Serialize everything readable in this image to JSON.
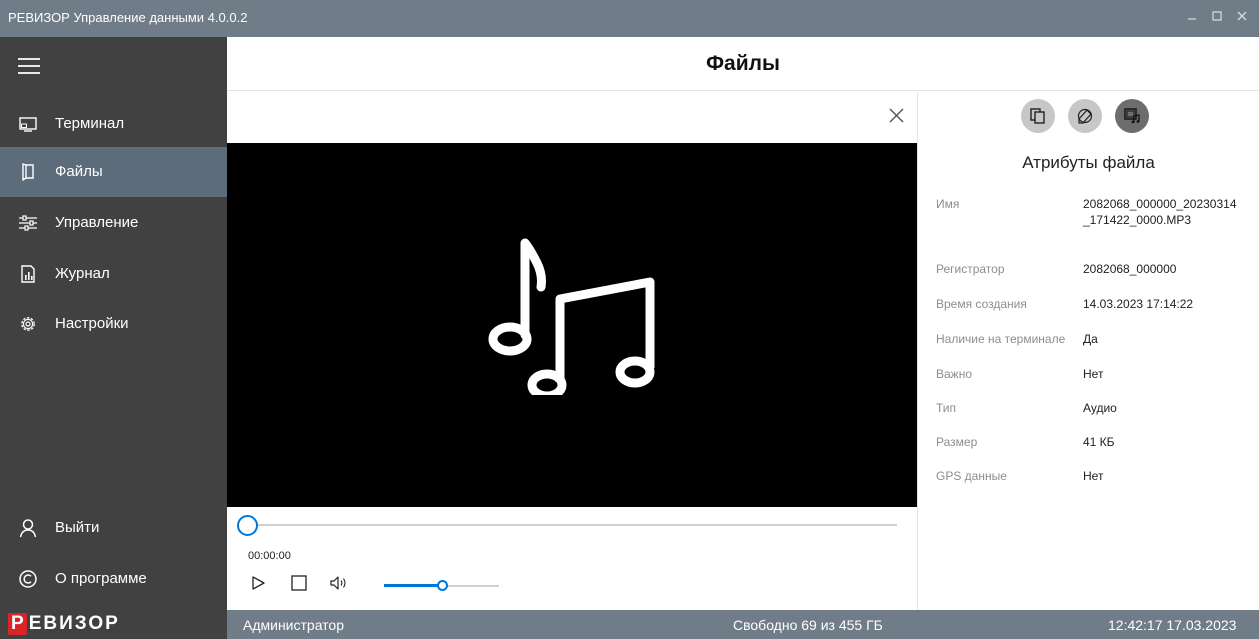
{
  "window": {
    "title": "РЕВИЗОР Управление данными 4.0.0.2"
  },
  "header": {
    "title": "Файлы"
  },
  "sidebar": {
    "items": [
      {
        "label": "Терминал",
        "icon": "monitor-icon",
        "active": false
      },
      {
        "label": "Файлы",
        "icon": "file-icon",
        "active": true
      },
      {
        "label": "Управление",
        "icon": "sliders-icon",
        "active": false
      },
      {
        "label": "Журнал",
        "icon": "journal-icon",
        "active": false
      },
      {
        "label": "Настройки",
        "icon": "gear-icon",
        "active": false
      }
    ],
    "bottom": [
      {
        "label": "Выйти",
        "icon": "user-icon"
      },
      {
        "label": "О программе",
        "icon": "copyright-icon"
      }
    ]
  },
  "player": {
    "timecode": "00:00:00",
    "seek_position": 0,
    "volume": 0.5,
    "media_icon": "music-notes-icon"
  },
  "attributes": {
    "title": "Атрибуты файла",
    "rows": [
      {
        "label": "Имя",
        "value": "2082068_000000_20230314_171422_0000.MP3"
      },
      {
        "label": "Регистратор",
        "value": "2082068_000000"
      },
      {
        "label": "Время создания",
        "value": "14.03.2023 17:14:22"
      },
      {
        "label": "Наличие на терминале",
        "value": "Да"
      },
      {
        "label": "Важно",
        "value": "Нет"
      },
      {
        "label": "Тип",
        "value": "Аудио"
      },
      {
        "label": "Размер",
        "value": "41 КБ"
      },
      {
        "label": "GPS данные",
        "value": "Нет"
      }
    ]
  },
  "statusbar": {
    "logo_first": "Р",
    "logo_rest": "ЕВИЗОР",
    "user": "Администратор",
    "disk": "Свободно 69 из 455 ГБ",
    "datetime": "12:42:17 17.03.2023"
  },
  "colors": {
    "sidebar": "#414141",
    "sidebar_active": "#5d6c7a",
    "titlebar": "#707c88",
    "accent": "#0078d7",
    "logo_red": "#d9252a"
  }
}
